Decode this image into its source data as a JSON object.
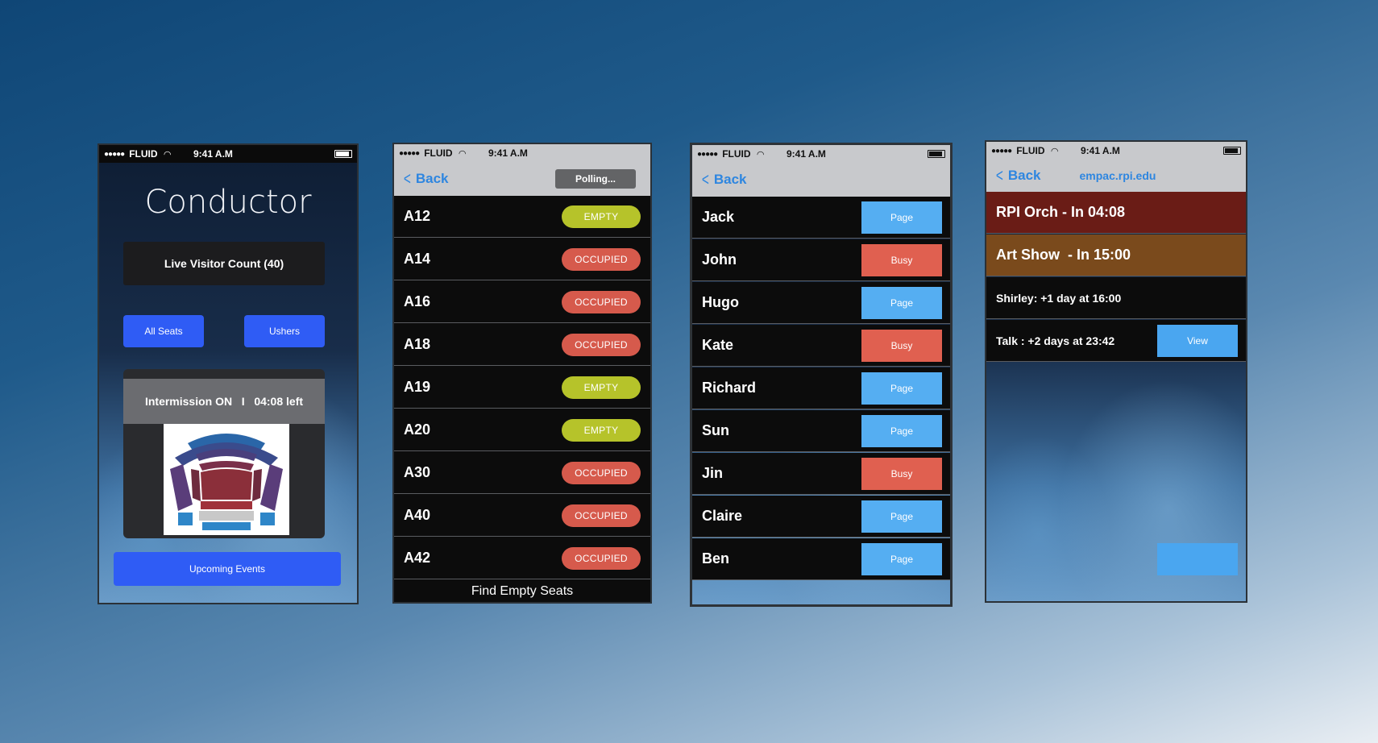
{
  "status_bar": {
    "carrier": "FLUID",
    "time": "9:41 A.M"
  },
  "screen1": {
    "title": "Conductor",
    "visitor_count": "Live Visitor Count (40)",
    "all_seats": "All Seats",
    "ushers": "Ushers",
    "intermission": "Intermission ON   I   04:08 left",
    "upcoming": "Upcoming Events",
    "accent": "#2f5cf5"
  },
  "screen2": {
    "back": "Back",
    "polling": "Polling...",
    "seats": [
      {
        "id": "A12",
        "status": "EMPTY"
      },
      {
        "id": "A14",
        "status": "OCCUPIED"
      },
      {
        "id": "A16",
        "status": "OCCUPIED"
      },
      {
        "id": "A18",
        "status": "OCCUPIED"
      },
      {
        "id": "A19",
        "status": "EMPTY"
      },
      {
        "id": "A20",
        "status": "EMPTY"
      },
      {
        "id": "A30",
        "status": "OCCUPIED"
      },
      {
        "id": "A40",
        "status": "OCCUPIED"
      },
      {
        "id": "A42",
        "status": "OCCUPIED"
      }
    ],
    "footer": "Find Empty Seats",
    "colors": {
      "EMPTY": "#b6c32a",
      "OCCUPIED": "#d65a4c"
    }
  },
  "screen3": {
    "back": "Back",
    "ushers": [
      {
        "name": "Jack",
        "action": "Page"
      },
      {
        "name": "John",
        "action": "Busy"
      },
      {
        "name": "Hugo",
        "action": "Page"
      },
      {
        "name": "Kate",
        "action": "Busy"
      },
      {
        "name": "Richard",
        "action": "Page"
      },
      {
        "name": "Sun",
        "action": "Page"
      },
      {
        "name": "Jin",
        "action": "Busy"
      },
      {
        "name": "Claire",
        "action": "Page"
      },
      {
        "name": "Ben",
        "action": "Page"
      }
    ],
    "colors": {
      "Page": "#55aef2",
      "Busy": "#e06050"
    }
  },
  "screen4": {
    "back": "Back",
    "url": "empac.rpi.edu",
    "events": [
      {
        "text": "RPI Orch - In 04:08",
        "color": "#6a1c16"
      },
      {
        "text": "Art Show  - In 15:00",
        "color": "#7a4a1c"
      },
      {
        "text": "Shirley: +1 day at 16:00",
        "color": "#0c0c0c"
      },
      {
        "text": "Talk : +2 days at 23:42",
        "color": "#0c0c0c"
      }
    ],
    "view": "View"
  }
}
